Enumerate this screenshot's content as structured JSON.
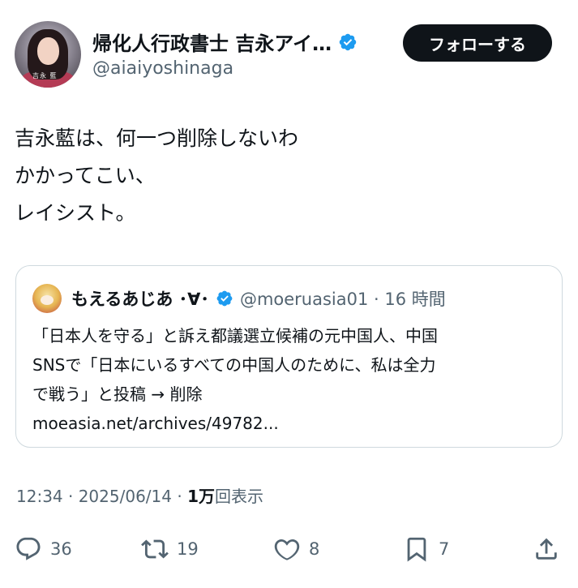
{
  "author": {
    "display_name": "帰化人行政書士 吉永アイ…",
    "handle": "@aiaiyoshinaga",
    "avatar_signature": "吉永 藍",
    "verified": true
  },
  "follow_button": "フォローする",
  "tweet": {
    "lines": [
      "吉永藍は、何一つ削除しないわ",
      "かかってこい、",
      "レイシスト。"
    ]
  },
  "quote": {
    "name": "もえるあじあ ･∀･",
    "handle_time": "@moeruasia01 · 16 時間",
    "lines": [
      "「日本人を守る」と訴え都議選立候補の元中国人、中国",
      "SNSで「日本にいるすべての中国人のために、私は全力",
      "で戦う」と投稿 → 削除",
      "moeasia.net/archives/49782..."
    ]
  },
  "meta": {
    "time_date": "12:34 · 2025/06/14 · ",
    "views_count": "1万",
    "views_label": "回表示"
  },
  "actions": {
    "replies": "36",
    "reposts": "19",
    "likes": "8",
    "bookmarks": "7"
  },
  "colors": {
    "verified": "#1d9bf0",
    "text": "#0f1419",
    "secondary": "#536471",
    "border": "#cfd9de"
  },
  "icons": [
    "verified-icon",
    "reply-icon",
    "repost-icon",
    "like-icon",
    "bookmark-icon",
    "share-icon"
  ]
}
